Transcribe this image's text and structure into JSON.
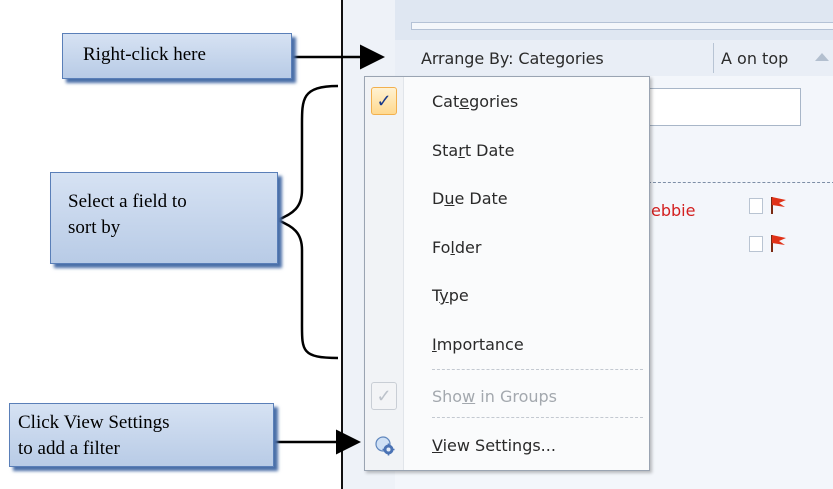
{
  "callouts": {
    "right_click": "Right-click here",
    "select_field_line1": "Select a field to",
    "select_field_line2": "sort by",
    "view_settings_line1": "Click View Settings",
    "view_settings_line2": "to add a filter"
  },
  "header": {
    "arrange_by": "Arrange By: Categories",
    "order": "A on top"
  },
  "task": {
    "name_fragment": "ebbie"
  },
  "menu": {
    "items": [
      {
        "pre": "Cat",
        "accel": "e",
        "post": "gories",
        "checked": true
      },
      {
        "pre": "Sta",
        "accel": "r",
        "post": "t Date"
      },
      {
        "pre": "D",
        "accel": "u",
        "post": "e Date"
      },
      {
        "pre": "Fo",
        "accel": "l",
        "post": "der"
      },
      {
        "pre": "T",
        "accel": "y",
        "post": "pe"
      },
      {
        "pre": "",
        "accel": "I",
        "post": "mportance"
      }
    ],
    "show_in_groups": {
      "pre": "Sho",
      "accel": "w",
      "post": " in Groups",
      "checked": true,
      "disabled": true
    },
    "view_settings": {
      "pre": "",
      "accel": "V",
      "post": "iew Settings..."
    },
    "check_glyph": "✓"
  },
  "colors": {
    "callout_border": "#5a7fb8",
    "task_red": "#d32020",
    "check_highlight": "#ffd98f"
  }
}
